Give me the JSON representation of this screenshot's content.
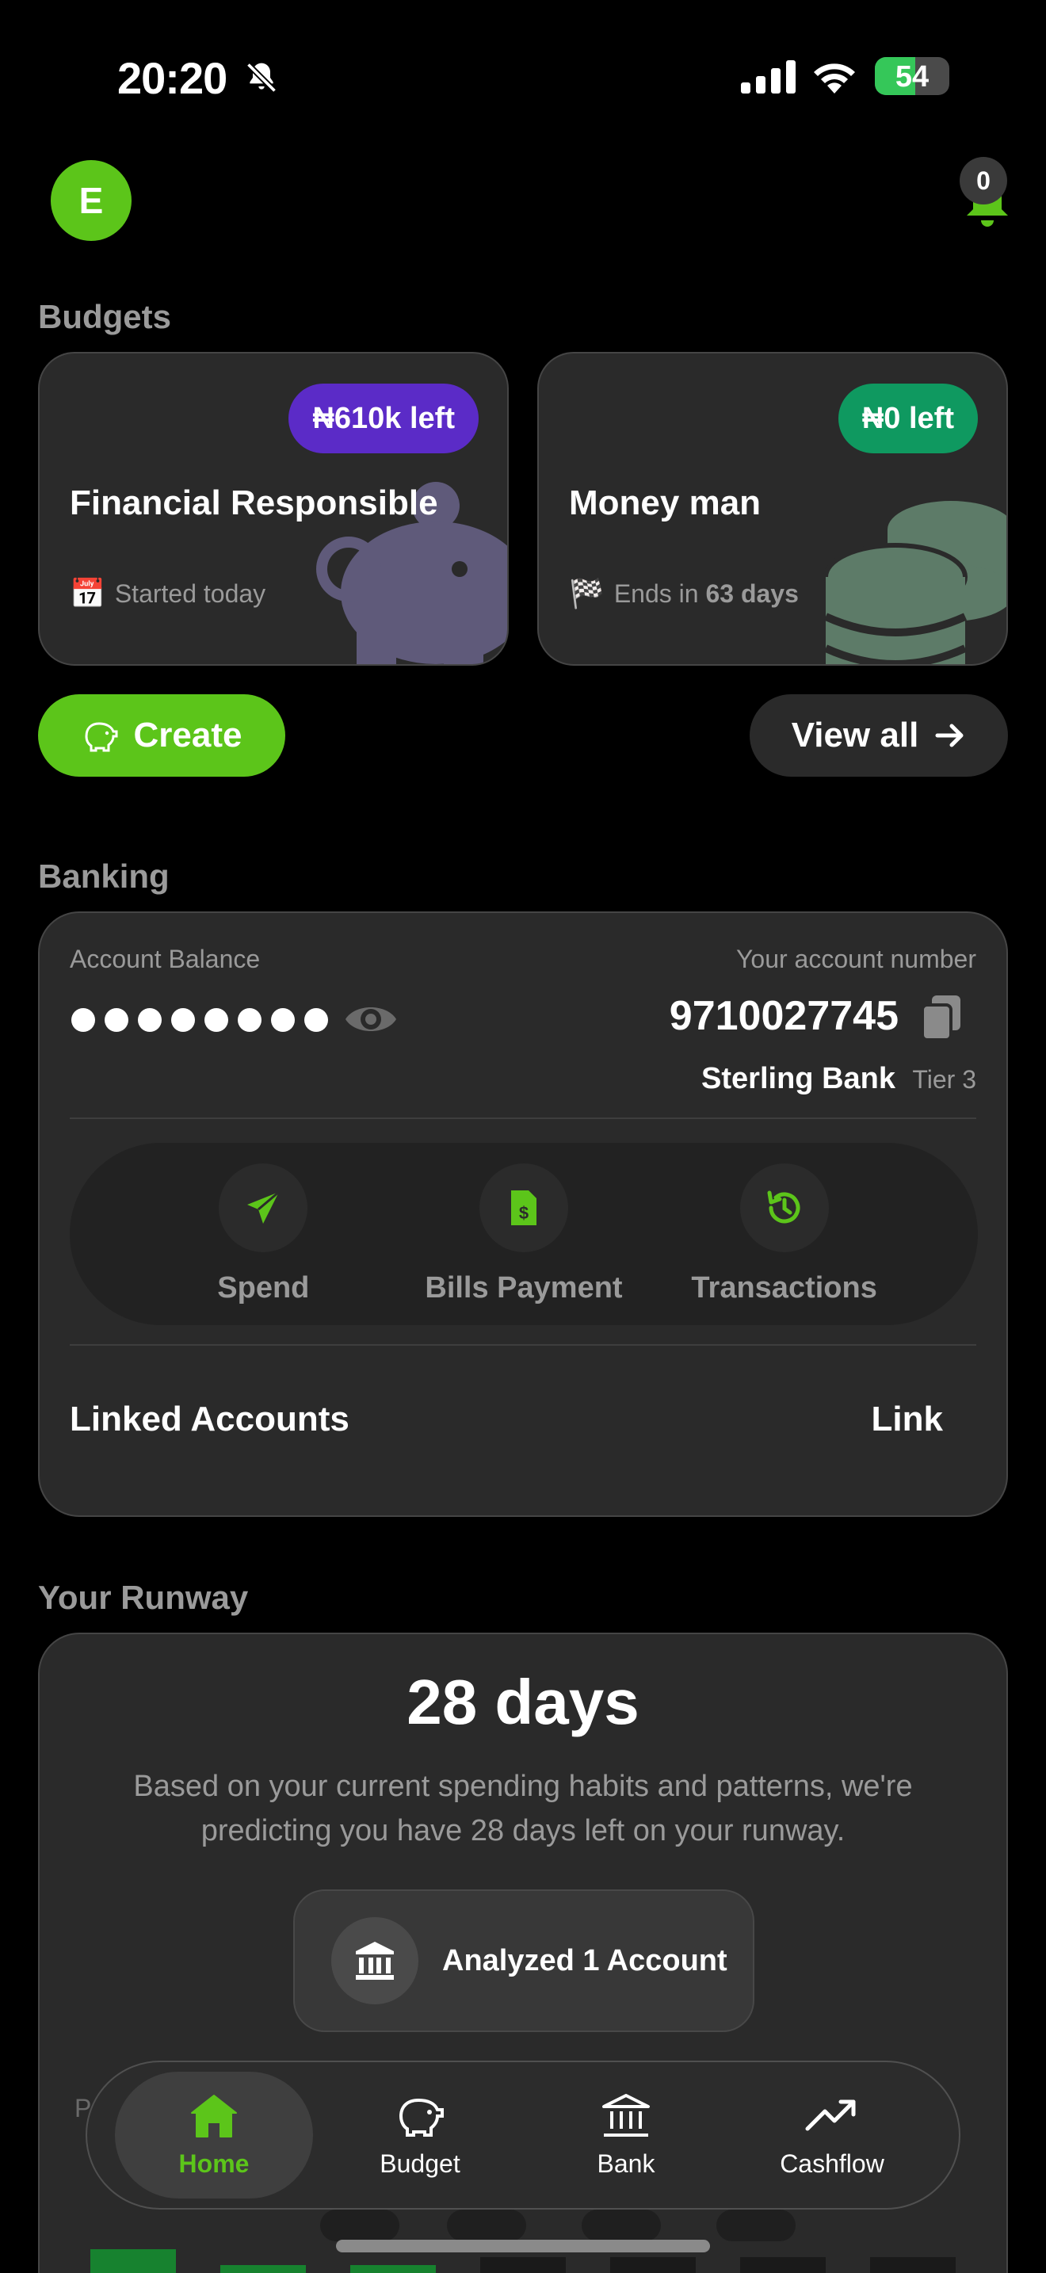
{
  "status_bar": {
    "time": "20:20",
    "battery_percent": "54",
    "battery_level": 0.54,
    "icons": [
      "bell-slash-icon",
      "cellular-signal-icon",
      "wifi-icon",
      "battery-charging-icon"
    ]
  },
  "header": {
    "avatar_initial": "E",
    "notification_count": "0"
  },
  "budgets": {
    "section_title": "Budgets",
    "cards": [
      {
        "name": "Financial Responsible",
        "left_label": "₦610k left",
        "pill_color": "#5b2bc7",
        "meta_emoji": "📅",
        "meta_text": "Started today",
        "art": "piggy-bank-icon"
      },
      {
        "name": "Money man",
        "left_label": "₦0 left",
        "pill_color": "#0f9960",
        "meta_emoji": "🏁",
        "meta_text": "Ends in ",
        "meta_bold": "63 days",
        "art": "coins-icon"
      }
    ],
    "create_label": "Create",
    "view_all_label": "View all"
  },
  "banking": {
    "section_title": "Banking",
    "balance_label": "Account Balance",
    "account_number_label": "Your account number",
    "account_number": "9710027745",
    "bank_name": "Sterling Bank",
    "tier": "Tier 3",
    "actions": [
      {
        "label": "Spend",
        "icon": "paper-plane-icon"
      },
      {
        "label": "Bills Payment",
        "icon": "invoice-dollar-icon"
      },
      {
        "label": "Transactions",
        "icon": "history-icon"
      }
    ],
    "linked_accounts_label": "Linked Accounts",
    "link_label": "Link"
  },
  "runway": {
    "section_title": "Your Runway",
    "days": "28 days",
    "description": "Based on your current spending habits and patterns, we're predicting you have 28 days left on your runway.",
    "analyzed_label": "Analyzed 1 Account",
    "chart_hint": "P"
  },
  "nav": {
    "items": [
      {
        "label": "Home",
        "icon": "home-icon",
        "active": true
      },
      {
        "label": "Budget",
        "icon": "piggy-bank-icon",
        "active": false
      },
      {
        "label": "Bank",
        "icon": "bank-icon",
        "active": false
      },
      {
        "label": "Cashflow",
        "icon": "trending-up-icon",
        "active": false
      }
    ]
  },
  "colors": {
    "accent": "#5cc51a",
    "card_bg": "#2a2a2a",
    "muted_text": "#9a9a9a"
  }
}
